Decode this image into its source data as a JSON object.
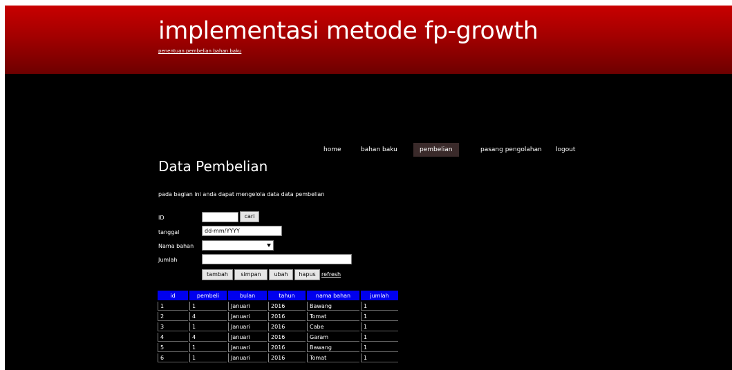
{
  "header": {
    "title": "implementasi metode fp-growth",
    "subtitle": "penentuan pembelian bahan baku"
  },
  "nav": {
    "items": [
      {
        "label": "home"
      },
      {
        "label": "bahan baku"
      },
      {
        "label": "pembelian"
      },
      {
        "label": "pasang pengolahan"
      },
      {
        "label": "logout"
      }
    ]
  },
  "page": {
    "title": "Data Pembelian",
    "intro": "pada bagian ini anda dapat mengelola data data pembelian"
  },
  "form": {
    "id_label": "ID",
    "id_value": "",
    "cari_label": "cari",
    "tanggal_label": "tanggal",
    "tanggal_value": "dd-mm/YYYY",
    "bahan_label": "Nama bahan",
    "bahan_value": "",
    "jumlah_label": "Jumlah",
    "jumlah_value": "",
    "buttons": {
      "tambah": "tambah",
      "simpan": "simpan",
      "ubah": "ubah",
      "hapus": "hapus"
    },
    "refresh_label": "refresh"
  },
  "table": {
    "headers": [
      "id",
      "pembeli",
      "bulan",
      "tahun",
      "nama bahan",
      "jumlah"
    ],
    "rows": [
      [
        "1",
        "1",
        "Januari",
        "2016",
        "Bawang",
        "1"
      ],
      [
        "2",
        "4",
        "Januari",
        "2016",
        "Tomat",
        "1"
      ],
      [
        "3",
        "1",
        "Januari",
        "2016",
        "Cabe",
        "1"
      ],
      [
        "4",
        "4",
        "Januari",
        "2016",
        "Garam",
        "1"
      ],
      [
        "5",
        "1",
        "Januari",
        "2016",
        "Bawang",
        "1"
      ],
      [
        "6",
        "1",
        "Januari",
        "2016",
        "Tomat",
        "1"
      ]
    ]
  },
  "colors": {
    "header_red": "#b30000",
    "page_background": "#000000",
    "table_header_blue": "#0000ee"
  }
}
